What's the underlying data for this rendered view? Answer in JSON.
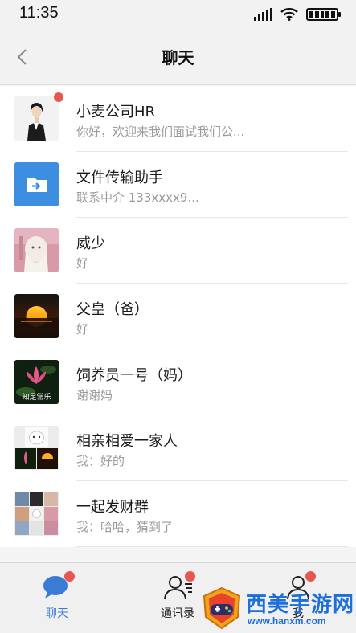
{
  "status_bar": {
    "time": "11:35"
  },
  "header": {
    "title": "聊天"
  },
  "chats": [
    {
      "name": "小麦公司HR",
      "preview": "你好，欢迎来我们面试我们公...",
      "unread": true
    },
    {
      "name": "文件传输助手",
      "preview": "联系中介 133xxxx9..."
    },
    {
      "name": "威少",
      "preview": "好"
    },
    {
      "name": "父皇（爸）",
      "preview": "好"
    },
    {
      "name": "饲养员一号（妈）",
      "preview": "谢谢妈",
      "avatar_caption": "知足常乐"
    },
    {
      "name": "相亲相爱一家人",
      "preview": "我：好的"
    },
    {
      "name": "一起发财群",
      "preview": "我：哈哈，猜到了"
    }
  ],
  "tabs": [
    {
      "label": "聊天",
      "active": true,
      "dot": true
    },
    {
      "label": "通讯录",
      "dot": true
    },
    {
      "label": "我",
      "dot": true
    }
  ],
  "watermark": {
    "title": "西美手游网",
    "url": "www.hanxm.com"
  },
  "colors": {
    "badge": "#e8574f",
    "active_tab": "#3a7bd5",
    "file_helper": "#3d8ee0"
  }
}
